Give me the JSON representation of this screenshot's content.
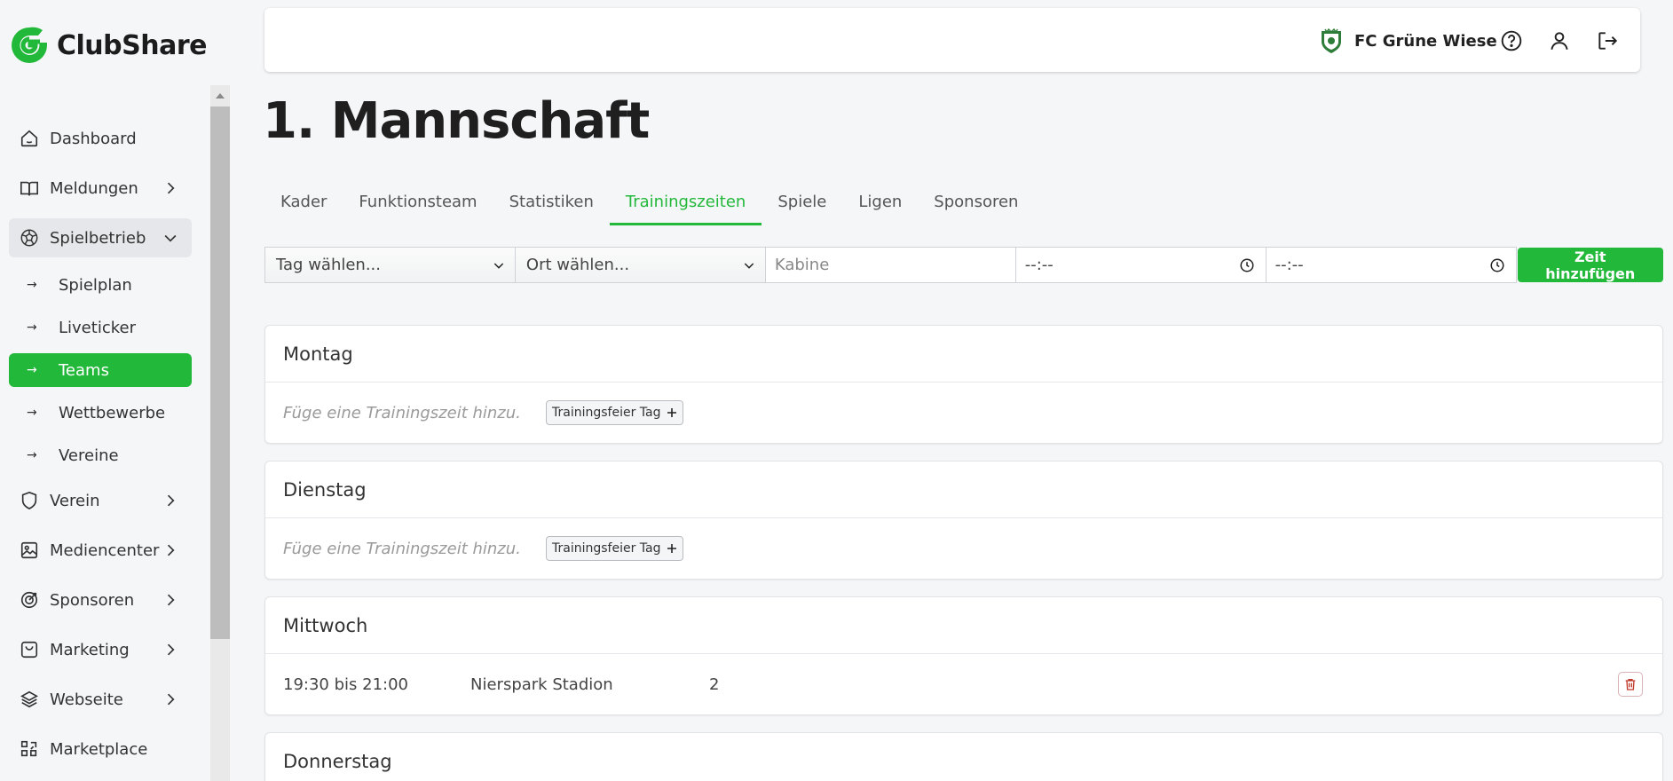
{
  "app": {
    "name": "ClubShare"
  },
  "header": {
    "club_name": "FC Grüne Wiese"
  },
  "sidebar": {
    "items": [
      {
        "label": "Dashboard"
      },
      {
        "label": "Meldungen"
      },
      {
        "label": "Spielbetrieb"
      },
      {
        "label": "Verein"
      },
      {
        "label": "Mediencenter"
      },
      {
        "label": "Sponsoren"
      },
      {
        "label": "Marketing"
      },
      {
        "label": "Webseite"
      },
      {
        "label": "Marketplace"
      }
    ],
    "subitems": [
      {
        "label": "Spielplan"
      },
      {
        "label": "Liveticker"
      },
      {
        "label": "Teams"
      },
      {
        "label": "Wettbewerbe"
      },
      {
        "label": "Vereine"
      }
    ]
  },
  "page": {
    "title": "1. Mannschaft"
  },
  "tabs": [
    {
      "label": "Kader"
    },
    {
      "label": "Funktionsteam"
    },
    {
      "label": "Statistiken"
    },
    {
      "label": "Trainingszeiten"
    },
    {
      "label": "Spiele"
    },
    {
      "label": "Ligen"
    },
    {
      "label": "Sponsoren"
    }
  ],
  "form": {
    "day_select": "Tag wählen...",
    "place_select": "Ort wählen...",
    "cabin_placeholder": "Kabine",
    "time_from": "--:--",
    "time_to": "--:--",
    "add_button": "Zeit hinzufügen"
  },
  "days": [
    {
      "name": "Montag",
      "empty_text": "Füge eine Trainingszeit hinzu.",
      "feier_label": "Trainingsfeier Tag"
    },
    {
      "name": "Dienstag",
      "empty_text": "Füge eine Trainingszeit hinzu.",
      "feier_label": "Trainingsfeier Tag"
    },
    {
      "name": "Mittwoch",
      "entry": {
        "time": "19:30 bis 21:00",
        "location": "Nierspark Stadion",
        "cabin": "2"
      }
    },
    {
      "name": "Donnerstag"
    }
  ],
  "colors": {
    "accent": "#22b83a",
    "danger": "#c0392b"
  }
}
